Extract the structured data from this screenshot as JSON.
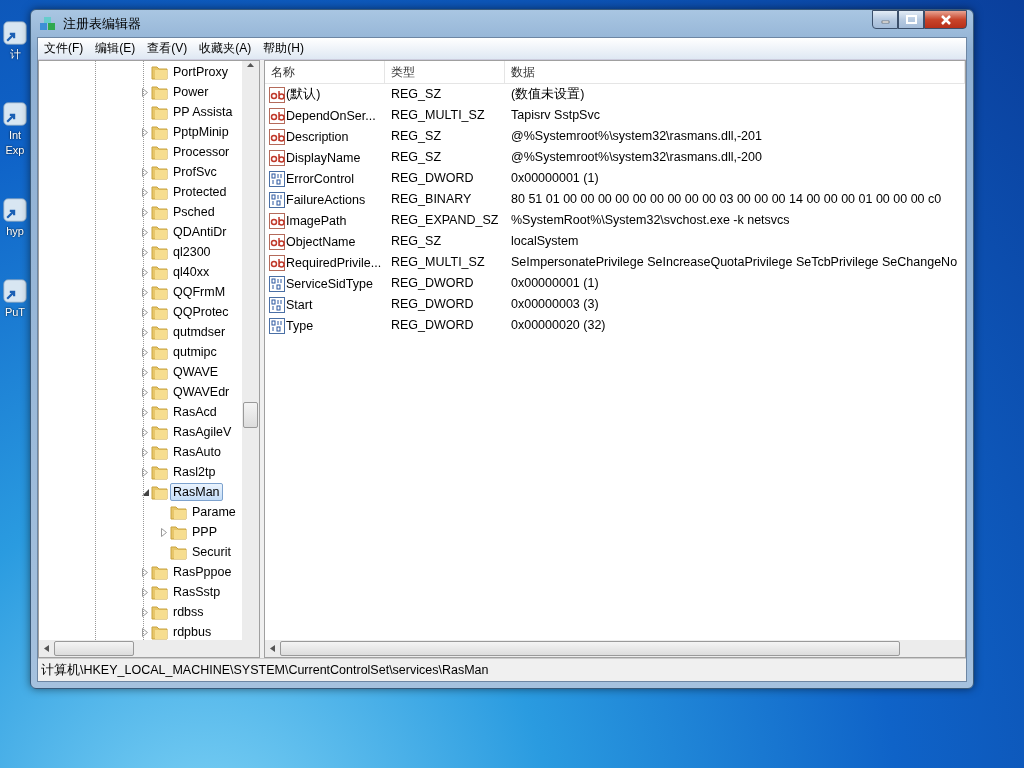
{
  "desktop_icons": [
    {
      "labels": [
        "计"
      ]
    },
    {
      "labels": [
        "Int",
        "Exp"
      ]
    },
    {
      "labels": [
        "hyp"
      ]
    },
    {
      "labels": [
        "PuT"
      ]
    }
  ],
  "window": {
    "title": "注册表编辑器"
  },
  "menu": [
    "文件(F)",
    "编辑(E)",
    "查看(V)",
    "收藏夹(A)",
    "帮助(H)"
  ],
  "tree": [
    {
      "label": "PortProxy",
      "has_children": false,
      "expanded": false,
      "selected": false
    },
    {
      "label": "Power",
      "has_children": true,
      "expanded": false,
      "selected": false
    },
    {
      "label": "PP Assista",
      "has_children": false,
      "expanded": false,
      "selected": false
    },
    {
      "label": "PptpMinip",
      "has_children": true,
      "expanded": false,
      "selected": false
    },
    {
      "label": "Processor",
      "has_children": false,
      "expanded": false,
      "selected": false
    },
    {
      "label": "ProfSvc",
      "has_children": true,
      "expanded": false,
      "selected": false
    },
    {
      "label": "Protected",
      "has_children": true,
      "expanded": false,
      "selected": false
    },
    {
      "label": "Psched",
      "has_children": true,
      "expanded": false,
      "selected": false
    },
    {
      "label": "QDAntiDr",
      "has_children": true,
      "expanded": false,
      "selected": false
    },
    {
      "label": "ql2300",
      "has_children": true,
      "expanded": false,
      "selected": false
    },
    {
      "label": "ql40xx",
      "has_children": true,
      "expanded": false,
      "selected": false
    },
    {
      "label": "QQFrmM",
      "has_children": true,
      "expanded": false,
      "selected": false
    },
    {
      "label": "QQProtec",
      "has_children": true,
      "expanded": false,
      "selected": false
    },
    {
      "label": "qutmdser",
      "has_children": true,
      "expanded": false,
      "selected": false
    },
    {
      "label": "qutmipc",
      "has_children": true,
      "expanded": false,
      "selected": false
    },
    {
      "label": "QWAVE",
      "has_children": true,
      "expanded": false,
      "selected": false
    },
    {
      "label": "QWAVEdr",
      "has_children": true,
      "expanded": false,
      "selected": false
    },
    {
      "label": "RasAcd",
      "has_children": true,
      "expanded": false,
      "selected": false
    },
    {
      "label": "RasAgileV",
      "has_children": true,
      "expanded": false,
      "selected": false
    },
    {
      "label": "RasAuto",
      "has_children": true,
      "expanded": false,
      "selected": false
    },
    {
      "label": "Rasl2tp",
      "has_children": true,
      "expanded": false,
      "selected": false
    },
    {
      "label": "RasMan",
      "has_children": true,
      "expanded": true,
      "selected": true,
      "children": [
        {
          "label": "Parame",
          "has_children": false,
          "expanded": false,
          "selected": false
        },
        {
          "label": "PPP",
          "has_children": true,
          "expanded": false,
          "selected": false
        },
        {
          "label": "Securit",
          "has_children": false,
          "expanded": false,
          "selected": false
        }
      ]
    },
    {
      "label": "RasPppoe",
      "has_children": true,
      "expanded": false,
      "selected": false
    },
    {
      "label": "RasSstp",
      "has_children": true,
      "expanded": false,
      "selected": false
    },
    {
      "label": "rdbss",
      "has_children": true,
      "expanded": false,
      "selected": false
    },
    {
      "label": "rdpbus",
      "has_children": true,
      "expanded": false,
      "selected": false
    }
  ],
  "table": {
    "columns": [
      "名称",
      "类型",
      "数据"
    ],
    "rows": [
      {
        "kind": "string",
        "name": "(默认)",
        "type": "REG_SZ",
        "data": "(数值未设置)"
      },
      {
        "kind": "string",
        "name": "DependOnSer...",
        "type": "REG_MULTI_SZ",
        "data": "Tapisrv SstpSvc"
      },
      {
        "kind": "string",
        "name": "Description",
        "type": "REG_SZ",
        "data": "@%Systemroot%\\system32\\rasmans.dll,-201"
      },
      {
        "kind": "string",
        "name": "DisplayName",
        "type": "REG_SZ",
        "data": "@%Systemroot%\\system32\\rasmans.dll,-200"
      },
      {
        "kind": "binary",
        "name": "ErrorControl",
        "type": "REG_DWORD",
        "data": "0x00000001 (1)"
      },
      {
        "kind": "binary",
        "name": "FailureActions",
        "type": "REG_BINARY",
        "data": "80 51 01 00 00 00 00 00 00 00 00 00 03 00 00 00 14 00 00 00 01 00 00 00 c0"
      },
      {
        "kind": "string",
        "name": "ImagePath",
        "type": "REG_EXPAND_SZ",
        "data": "%SystemRoot%\\System32\\svchost.exe -k netsvcs"
      },
      {
        "kind": "string",
        "name": "ObjectName",
        "type": "REG_SZ",
        "data": "localSystem"
      },
      {
        "kind": "string",
        "name": "RequiredPrivile...",
        "type": "REG_MULTI_SZ",
        "data": "SeImpersonatePrivilege SeIncreaseQuotaPrivilege SeTcbPrivilege SeChangeNo"
      },
      {
        "kind": "binary",
        "name": "ServiceSidType",
        "type": "REG_DWORD",
        "data": "0x00000001 (1)"
      },
      {
        "kind": "binary",
        "name": "Start",
        "type": "REG_DWORD",
        "data": "0x00000003 (3)"
      },
      {
        "kind": "binary",
        "name": "Type",
        "type": "REG_DWORD",
        "data": "0x00000020 (32)"
      }
    ]
  },
  "status_bar": "计算机\\HKEY_LOCAL_MACHINE\\SYSTEM\\CurrentControlSet\\services\\RasMan"
}
